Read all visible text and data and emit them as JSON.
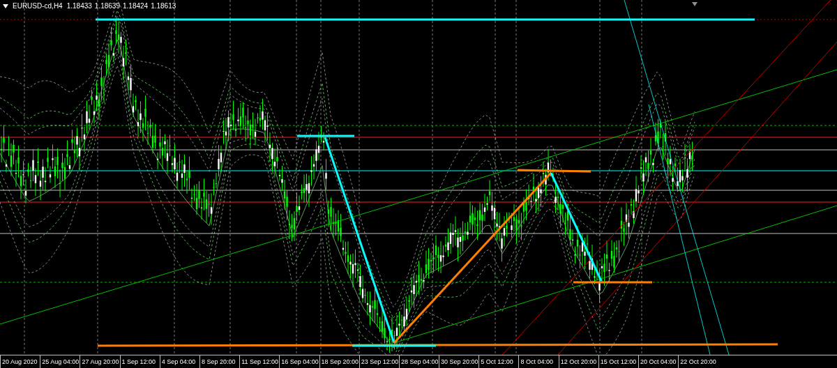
{
  "chart": {
    "symbol": "EURUSD-cd,H4",
    "ohlc": [
      "1.18433",
      "1.18639",
      "1.18424",
      "1.18613"
    ]
  },
  "time_axis": [
    "20 Aug 2020",
    "25 Aug 04:00",
    "27 Aug 20:00",
    "1 Sep 12:00",
    "4 Sep 04:00",
    "8 Sep 20:00",
    "11 Sep 12:00",
    "16 Sep 04:00",
    "18 Sep 20:00",
    "23 Sep 12:00",
    "28 Sep 04:00",
    "30 Sep 20:00",
    "5 Oct 12:00",
    "8 Oct 04:00",
    "12 Oct 20:00",
    "15 Oct 12:00",
    "20 Oct 04:00",
    "22 Oct 20:00"
  ]
}
